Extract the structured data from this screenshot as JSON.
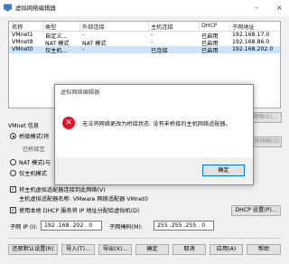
{
  "window": {
    "title": "虚拟网络编辑器"
  },
  "table": {
    "headers": [
      "名称",
      "类型",
      "外部连接",
      "主机连接",
      "DHCP",
      "子网地址"
    ],
    "rows": [
      [
        "VMnet1",
        "自定义...",
        "-",
        "-",
        "已启用",
        "192.168.17.0"
      ],
      [
        "VMnet8",
        "NAT 模式",
        "NAT 模式",
        "-",
        "已启用",
        "192.168.86.0"
      ],
      [
        "VMnet0",
        "仅主机...",
        "-",
        "已连接",
        "已启用",
        "192.168.202.0"
      ]
    ]
  },
  "buttons": {
    "add_network": "添加网络(E)...",
    "remove_network": "移除网络(O)",
    "rename_network": "重命名网络(W)...",
    "dhcp_settings": "DHCP 设置(P)...",
    "restore_defaults": "还原默认设置(R)",
    "import": "导入(T)...",
    "export": "导出(X)...",
    "ok": "确定",
    "cancel": "取消",
    "apply": "应用(A)",
    "help": "帮助"
  },
  "vmnet_info": {
    "heading": "VMnet 信息",
    "bridge_mode": "桥接模式(将",
    "bridged_to": "已桥接至",
    "nat_mode": "NAT 模式(与",
    "host_only": "仅主机模式",
    "connect_adapter": "将主机虚拟适配器连接到此网络(V)",
    "adapter_name": "主机虚拟适配器名称: VMware 网络适配器 VMnet0",
    "use_dhcp": "使用本地 DHCP 服务将 IP 地址分配给虚拟机(D)",
    "subnet_ip_label": "子网 IP (I):",
    "subnet_ip": "192 .168 .202 . 0",
    "subnet_mask_label": "子网掩码(M):",
    "subnet_mask": "255 .255 .255 . 0"
  },
  "dialog": {
    "title": "虚拟网络编辑器",
    "message": "无法将网络更改为桥接状态: 没有未桥接的主机网络适配器。",
    "ok": "确定"
  }
}
